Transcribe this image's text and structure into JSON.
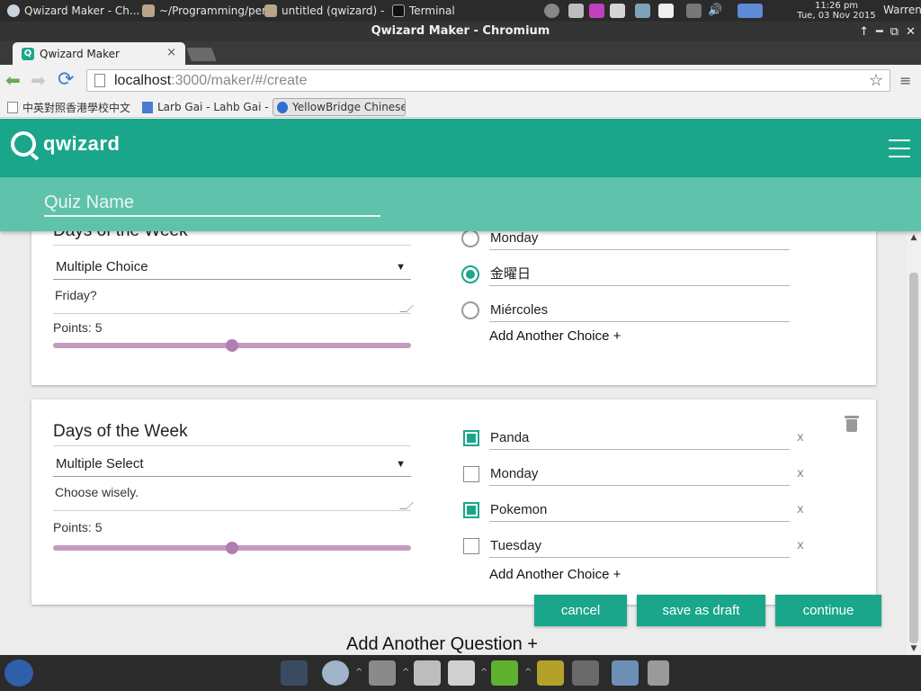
{
  "os_panel": {
    "tasks": [
      {
        "label": "Qwizard Maker - Ch..."
      },
      {
        "label": "~/Programming/per..."
      },
      {
        "label": "untitled (qwizard) - ..."
      },
      {
        "label": "Terminal"
      }
    ],
    "clock_time": "11:26 pm",
    "clock_date": "Tue, 03 Nov 2015",
    "user": "Warren"
  },
  "window": {
    "title": "Qwizard Maker - Chromium",
    "controls": [
      "↑",
      "━",
      "⧉",
      "✕"
    ]
  },
  "browser": {
    "tab_title": "Qwizard Maker",
    "tab_close": "×",
    "url_host": "localhost",
    "url_path": ":3000/maker/#/create",
    "bookmarks": [
      {
        "label": "中英對照香港學校中文"
      },
      {
        "label": "Larb Gai - Lahb Gai - L"
      },
      {
        "label": "YellowBridge Chinese-E"
      }
    ]
  },
  "app": {
    "brand": "qwizard",
    "quiz_name_placeholder": "Quiz Name",
    "accent_color": "#1aa68a",
    "slider_color": "#c49bc0"
  },
  "questions": [
    {
      "title": "Days of the Week",
      "type": "Multiple Choice",
      "description": "Friday?",
      "points_label": "Points: 5",
      "points_fraction": 0.5,
      "choices": [
        {
          "text": "Monday",
          "selected": false
        },
        {
          "text": "金曜日",
          "selected": true
        },
        {
          "text": "Miércoles",
          "selected": false
        }
      ],
      "add_choice_label": "Add Another Choice +"
    },
    {
      "title": "Days of the Week",
      "type": "Multiple Select",
      "description": "Choose wisely.",
      "points_label": "Points: 5",
      "points_fraction": 0.5,
      "choices": [
        {
          "text": "Panda",
          "selected": true,
          "remove": "x"
        },
        {
          "text": "Monday",
          "selected": false,
          "remove": "x"
        },
        {
          "text": "Pokemon",
          "selected": true,
          "remove": "x"
        },
        {
          "text": "Tuesday",
          "selected": false,
          "remove": "x"
        }
      ],
      "add_choice_label": "Add Another Choice +"
    }
  ],
  "actions": {
    "cancel": "cancel",
    "save_draft": "save as draft",
    "continue": "continue",
    "add_question": "Add Another Question +"
  },
  "icons": {
    "select_caret": "▼",
    "star": "☆",
    "back": "⬅",
    "forward": "➡",
    "reload": "⟳",
    "menu": "≡",
    "scroll_up": "▲",
    "scroll_down": "▼"
  }
}
